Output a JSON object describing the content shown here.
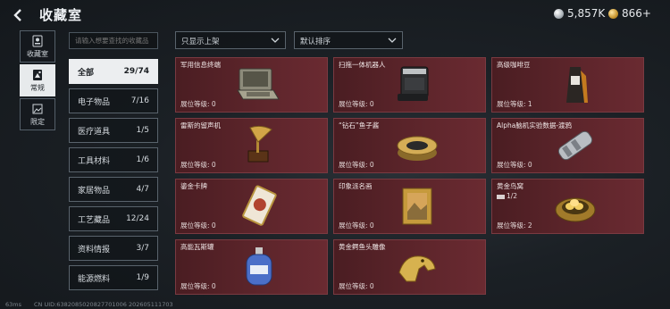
{
  "header": {
    "title": "收藏室",
    "currency": [
      {
        "icon": "silver-coin-icon",
        "value": "5,857K"
      },
      {
        "icon": "gold-coin-icon",
        "value": "866+"
      }
    ]
  },
  "side_nav": [
    {
      "label": "收藏室",
      "icon": "id-card-icon",
      "active": false
    },
    {
      "label": "常规",
      "icon": "collection-icon",
      "active": true
    },
    {
      "label": "限定",
      "icon": "image-frame-icon",
      "active": false
    }
  ],
  "search": {
    "placeholder": "请输入想要查找的收藏品"
  },
  "filters": [
    {
      "label": "只显示上架"
    },
    {
      "label": "默认排序"
    }
  ],
  "categories": [
    {
      "label": "全部",
      "count": "29/74",
      "active": true
    },
    {
      "label": "电子物品",
      "count": "7/16"
    },
    {
      "label": "医疗道具",
      "count": "1/5"
    },
    {
      "label": "工具材料",
      "count": "1/6"
    },
    {
      "label": "家居物品",
      "count": "4/7"
    },
    {
      "label": "工艺藏品",
      "count": "12/24"
    },
    {
      "label": "资料情报",
      "count": "3/7"
    },
    {
      "label": "能源燃料",
      "count": "1/9"
    }
  ],
  "items": [
    {
      "name": "军用信息终端",
      "level": "展位等级: 0",
      "icon": "military-terminal-icon"
    },
    {
      "name": "扫拖一体机器人",
      "level": "展位等级: 0",
      "icon": "robot-vacuum-icon"
    },
    {
      "name": "高级咖啡豆",
      "level": "展位等级: 1",
      "icon": "coffee-bean-bag-icon"
    },
    {
      "name": "雷斯的留声机",
      "level": "展位等级: 0",
      "icon": "gramophone-icon"
    },
    {
      "name": "“钻石”鱼子酱",
      "level": "展位等级: 0",
      "icon": "caviar-tin-icon"
    },
    {
      "name": "Alpha脑机实验数据-渡鸦",
      "level": "展位等级: 0",
      "icon": "data-capsule-icon"
    },
    {
      "name": "鎏金卡牌",
      "level": "展位等级: 0",
      "icon": "gilded-card-icon"
    },
    {
      "name": "印象派名画",
      "level": "展位等级: 0",
      "icon": "painting-icon"
    },
    {
      "name": "黄金鸟窝",
      "level": "展位等级: 2",
      "count": "1/2",
      "icon": "golden-nest-icon"
    },
    {
      "name": "高能瓦斯罐",
      "level": "展位等级: 0",
      "icon": "gas-canister-icon"
    },
    {
      "name": "黄金鳄鱼头雕像",
      "level": "展位等级: 0",
      "icon": "gold-crocodile-statue-icon"
    }
  ],
  "footer": {
    "latency": "63ms",
    "uid": "CN UID:6382085020827701006 202605111703"
  },
  "colors": {
    "card_bg": "#5d252b",
    "active_tab": "#eceef0",
    "page_bg": "#1b2025"
  }
}
